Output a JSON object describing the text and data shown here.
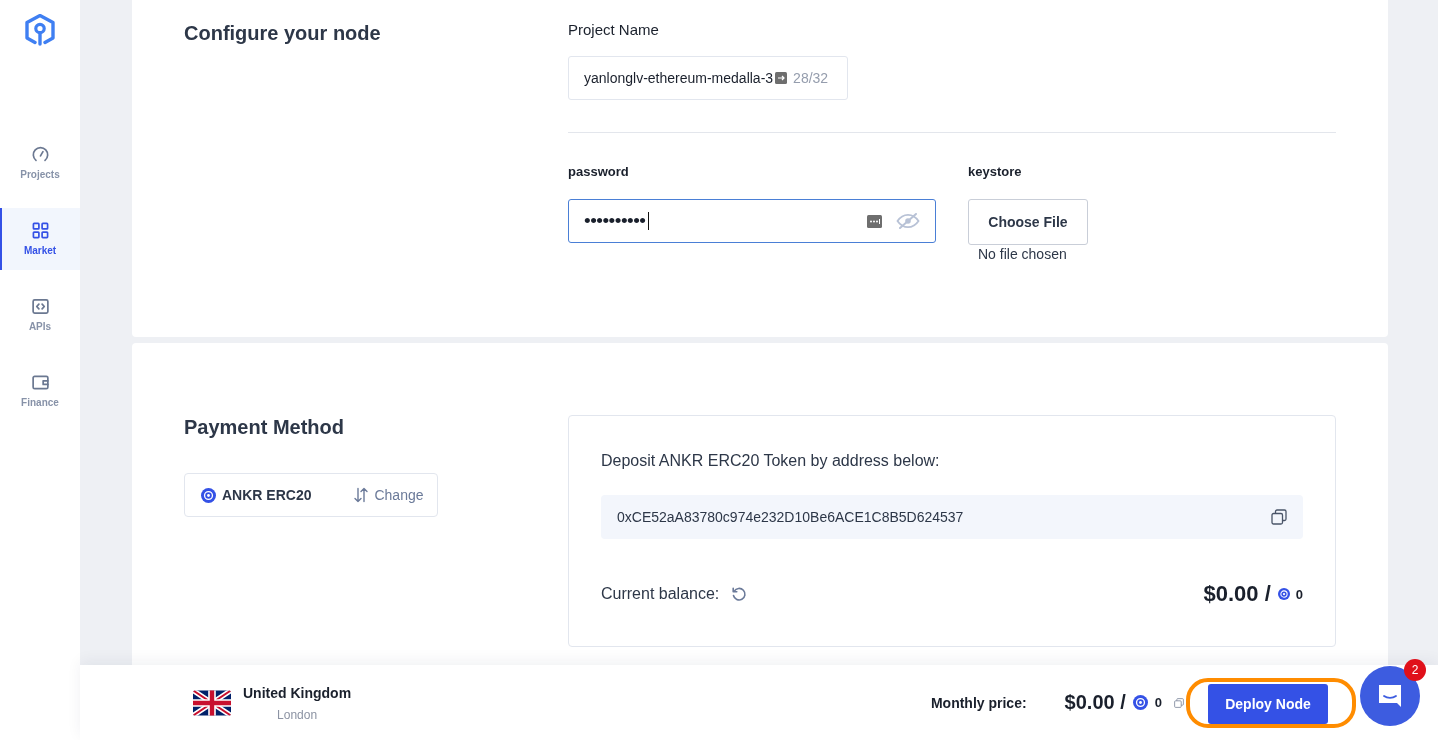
{
  "sidebar": {
    "items": [
      {
        "label": "Projects",
        "selected": false
      },
      {
        "label": "Market",
        "selected": true
      },
      {
        "label": "APIs",
        "selected": false
      },
      {
        "label": "Finance",
        "selected": false
      }
    ]
  },
  "configure": {
    "title": "Configure your node",
    "project_name": {
      "label": "Project Name",
      "value": "yanlonglv-ethereum-medalla-3",
      "counter": "28/32"
    },
    "password": {
      "label": "password",
      "value": "••••••••••",
      "focused": true
    },
    "keystore": {
      "label": "keystore",
      "button": "Choose File",
      "status": "No file chosen"
    }
  },
  "payment": {
    "title": "Payment Method",
    "method": "ANKR ERC20",
    "change": "Change",
    "deposit_label": "Deposit ANKR ERC20 Token by address below:",
    "address": "0xCE52aA83780c974e232D10Be6ACE1C8B5D624537",
    "balance_label": "Current balance:",
    "balance_usd": "$0.00 /",
    "balance_tokens": "0"
  },
  "footer": {
    "country": "United Kingdom",
    "city": "London",
    "price_label": "Monthly price:",
    "price_usd": "$0.00 /",
    "price_tokens": "0",
    "deploy": "Deploy Node",
    "highlighted": true
  },
  "chat": {
    "badge": "2"
  }
}
